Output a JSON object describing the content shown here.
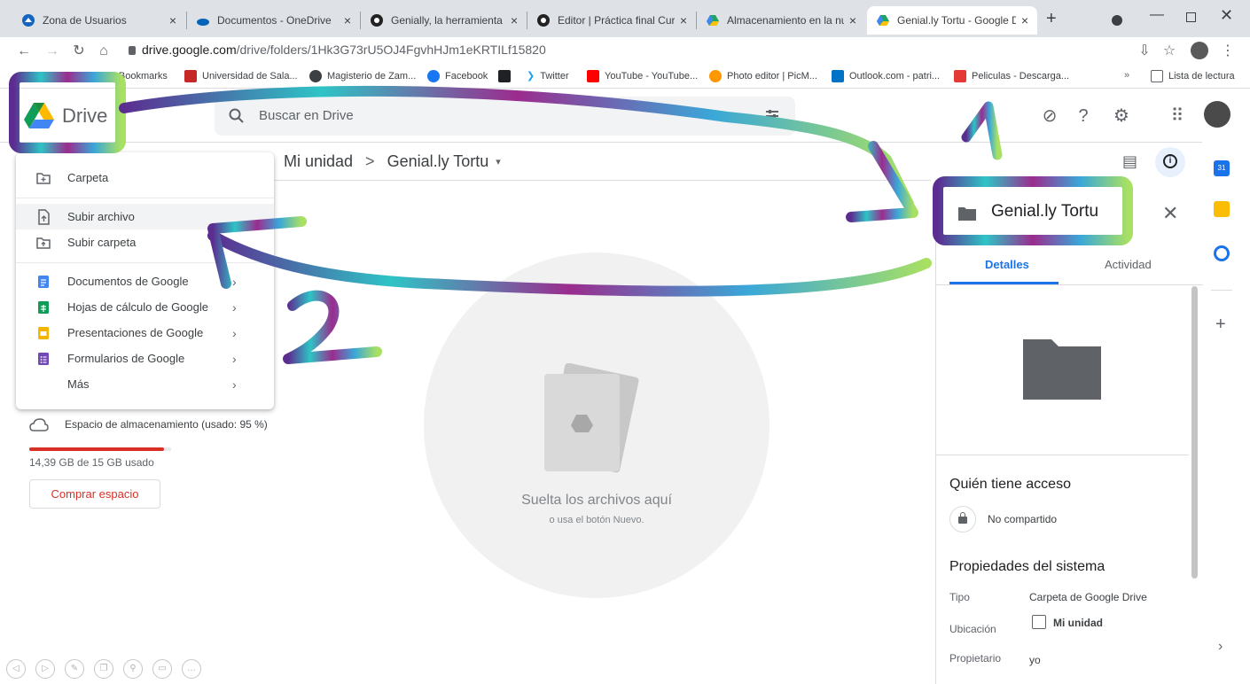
{
  "browser": {
    "tabs": [
      {
        "title": "Zona de Usuarios",
        "icon": "zona-favicon",
        "active": false
      },
      {
        "title": "Documentos - OneDrive",
        "icon": "onedrive-favicon",
        "active": false
      },
      {
        "title": "Genially, la herramienta para",
        "icon": "genially-favicon",
        "active": false
      },
      {
        "title": "Editor | Práctica final Curso",
        "icon": "genially-favicon",
        "active": false
      },
      {
        "title": "Almacenamiento en la nube",
        "icon": "drive-favicon",
        "active": false
      },
      {
        "title": "Genial.ly Tortu - Google Dri",
        "icon": "drive-favicon",
        "active": true
      }
    ],
    "url_host": "drive.google.com",
    "url_path": "/drive/folders/1Hk3G73rU5OJ4FgvhHJm1eKRTILf15820",
    "bookmarks": [
      "Bookmarks",
      "Universidad de Sala...",
      "Magisterio de Zam...",
      "Facebook",
      "Twitter",
      "YouTube - YouTube...",
      "Photo editor | PicM...",
      "Outlook.com - patri...",
      "Peliculas - Descarga..."
    ],
    "reading_list": "Lista de lectura",
    "more_bookmarks": "»"
  },
  "drive": {
    "logo_text": "Drive",
    "search_placeholder": "Buscar en Drive",
    "breadcrumb": {
      "root": "Mi unidad",
      "separator": ">",
      "current": "Genial.ly Tortu"
    },
    "new_menu": {
      "items": [
        {
          "label": "Carpeta",
          "icon": "new-folder-icon"
        },
        {
          "label": "Subir archivo",
          "icon": "file-upload-icon"
        },
        {
          "label": "Subir carpeta",
          "icon": "folder-upload-icon"
        },
        {
          "label": "Documentos de Google",
          "icon": "google-docs-icon"
        },
        {
          "label": "Hojas de cálculo de Google",
          "icon": "google-sheets-icon"
        },
        {
          "label": "Presentaciones de Google",
          "icon": "google-slides-icon"
        },
        {
          "label": "Formularios de Google",
          "icon": "google-forms-icon"
        },
        {
          "label": "Más",
          "icon": ""
        }
      ]
    },
    "storage": {
      "label": "Espacio de almacenamiento (usado: 95 %)",
      "used_text": "14,39 GB de 15 GB usado",
      "buy_label": "Comprar espacio",
      "fraction": 0.95
    },
    "dropzone": {
      "title": "Suelta los archivos aquí",
      "subtitle": "o usa el botón Nuevo."
    },
    "details": {
      "title": "Genial.ly Tortu",
      "tabs": [
        "Detalles",
        "Actividad"
      ],
      "access_title": "Quién tiene acceso",
      "access_value": "No compartido",
      "props_title": "Propiedades del sistema",
      "props": [
        {
          "key": "Tipo",
          "value": "Carpeta de Google Drive"
        },
        {
          "key": "Ubicación",
          "value": "Mi unidad"
        },
        {
          "key": "Propietario",
          "value": "yo"
        }
      ]
    }
  },
  "annotations": {
    "step1": "1",
    "step2": "2"
  },
  "colors": {
    "accent": "#1a73e8",
    "danger": "#d93025",
    "panel": "#f1f3f4"
  }
}
